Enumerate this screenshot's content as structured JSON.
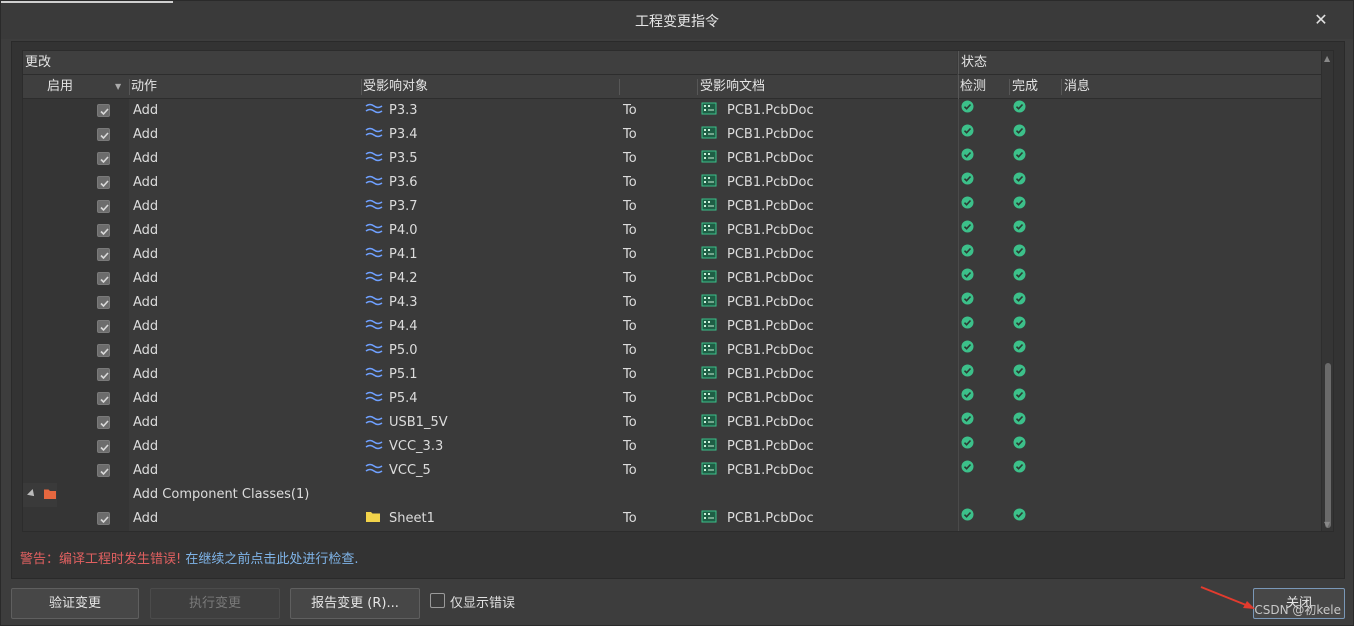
{
  "window": {
    "title": "工程变更指令",
    "close_glyph": "✕"
  },
  "grid": {
    "group_headers": {
      "changes": "更改",
      "status": "状态"
    },
    "columns": {
      "enable": "启用",
      "action": "动作",
      "affected_object": "受影响对象",
      "affected_document": "受影响文档",
      "check": "检测",
      "done": "完成",
      "message": "消息"
    },
    "rows": [
      {
        "action": "Add",
        "object": "P3.3",
        "to": "To",
        "doc": "PCB1.PcbDoc"
      },
      {
        "action": "Add",
        "object": "P3.4",
        "to": "To",
        "doc": "PCB1.PcbDoc"
      },
      {
        "action": "Add",
        "object": "P3.5",
        "to": "To",
        "doc": "PCB1.PcbDoc"
      },
      {
        "action": "Add",
        "object": "P3.6",
        "to": "To",
        "doc": "PCB1.PcbDoc"
      },
      {
        "action": "Add",
        "object": "P3.7",
        "to": "To",
        "doc": "PCB1.PcbDoc"
      },
      {
        "action": "Add",
        "object": "P4.0",
        "to": "To",
        "doc": "PCB1.PcbDoc"
      },
      {
        "action": "Add",
        "object": "P4.1",
        "to": "To",
        "doc": "PCB1.PcbDoc"
      },
      {
        "action": "Add",
        "object": "P4.2",
        "to": "To",
        "doc": "PCB1.PcbDoc"
      },
      {
        "action": "Add",
        "object": "P4.3",
        "to": "To",
        "doc": "PCB1.PcbDoc"
      },
      {
        "action": "Add",
        "object": "P4.4",
        "to": "To",
        "doc": "PCB1.PcbDoc"
      },
      {
        "action": "Add",
        "object": "P5.0",
        "to": "To",
        "doc": "PCB1.PcbDoc"
      },
      {
        "action": "Add",
        "object": "P5.1",
        "to": "To",
        "doc": "PCB1.PcbDoc"
      },
      {
        "action": "Add",
        "object": "P5.4",
        "to": "To",
        "doc": "PCB1.PcbDoc"
      },
      {
        "action": "Add",
        "object": "USB1_5V",
        "to": "To",
        "doc": "PCB1.PcbDoc"
      },
      {
        "action": "Add",
        "object": "VCC_3.3",
        "to": "To",
        "doc": "PCB1.PcbDoc"
      },
      {
        "action": "Add",
        "object": "VCC_5",
        "to": "To",
        "doc": "PCB1.PcbDoc"
      }
    ],
    "group_row": {
      "label": "Add Component Classes(1)"
    },
    "class_rows": [
      {
        "action": "Add",
        "object": "Sheet1",
        "to": "To",
        "doc": "PCB1.PcbDoc"
      }
    ],
    "colors": {
      "ok": "#3cc08a",
      "net_icon": "#6fa0ff",
      "folder_icon": "#f2d34a",
      "group_folder": "#e5673f"
    }
  },
  "warning": {
    "text": "警告：编译工程时发生错误!",
    "link": "在继续之前点击此处进行检查."
  },
  "buttons": {
    "validate": "验证变更",
    "execute": "执行变更",
    "report": "报告变更 (R)...",
    "show_errors_only": "仅显示错误",
    "close": "关闭"
  },
  "watermark": "CSDN @初kele"
}
